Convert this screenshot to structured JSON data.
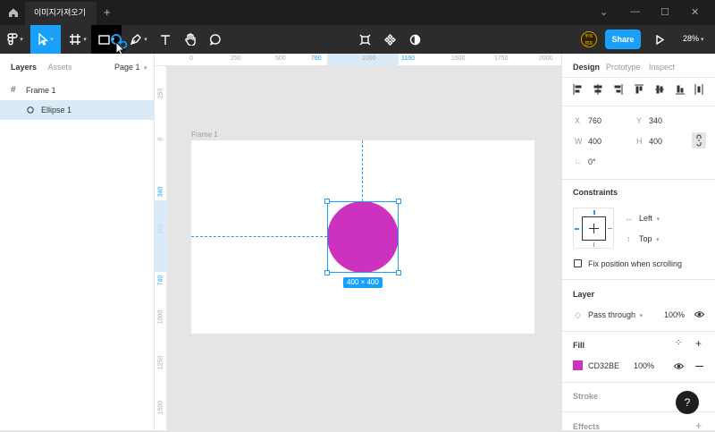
{
  "titlebar": {
    "tab_title": "이미지가져오기",
    "plus": "+",
    "minimize": "—",
    "maximize": "☐",
    "close": "✕",
    "chevron": "⌄"
  },
  "toolbar": {
    "share_label": "Share",
    "zoom": "28%"
  },
  "avatar": {
    "text_top": "부트",
    "text_bottom": "캠프"
  },
  "left_panel": {
    "tabs": {
      "layers": "Layers",
      "assets": "Assets"
    },
    "page_selector": "Page 1",
    "layers": [
      {
        "name": "Frame 1",
        "type": "frame"
      },
      {
        "name": "Ellipse 1",
        "type": "ellipse",
        "selected": true
      }
    ]
  },
  "rulers": {
    "horizontal": [
      "0",
      "250",
      "500",
      "760",
      "1000",
      "1160",
      "1250",
      "1500",
      "1750",
      "2000"
    ],
    "vertical": [
      "250",
      "0",
      "340",
      "500",
      "740",
      "1000",
      "1250",
      "1500"
    ]
  },
  "canvas": {
    "frame_label": "Frame 1",
    "selection_size": "400 × 400",
    "ellipse_color": "#CD32BE"
  },
  "right_panel": {
    "tabs": {
      "design": "Design",
      "prototype": "Prototype",
      "inspect": "Inspect"
    },
    "x_label": "X",
    "x_value": "760",
    "y_label": "Y",
    "y_value": "340",
    "w_label": "W",
    "w_value": "400",
    "h_label": "H",
    "h_value": "400",
    "rotation": "0°",
    "constraints_title": "Constraints",
    "constraint_h": "Left",
    "constraint_v": "Top",
    "fix_position": "Fix position when scrolling",
    "layer_title": "Layer",
    "blend_mode": "Pass through",
    "layer_opacity": "100%",
    "fill_title": "Fill",
    "fill_hex": "CD32BE",
    "fill_opacity": "100%",
    "stroke_title": "Stroke",
    "effects_title": "Effects"
  },
  "help": "?",
  "colors": {
    "accent": "#18A0FB",
    "fill": "#CD32BE",
    "toolbar": "#2C2C2C",
    "titlebar": "#1E1E1E"
  }
}
